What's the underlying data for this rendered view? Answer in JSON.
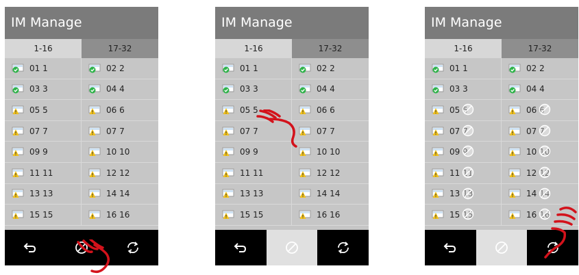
{
  "title": "IM Manage",
  "tabs": [
    "1-16",
    "17-32"
  ],
  "rows": [
    [
      "01 1",
      "02 2"
    ],
    [
      "03 3",
      "04 4"
    ],
    [
      "05 5",
      "06 6"
    ],
    [
      "07 7",
      "07 7"
    ],
    [
      "09 9",
      "10 10"
    ],
    [
      "11 11",
      "12 12"
    ],
    [
      "13 13",
      "14 14"
    ],
    [
      "15 15",
      "16 16"
    ]
  ],
  "status_rows": [
    [
      "online",
      "online"
    ],
    [
      "online",
      "online"
    ],
    [
      "warning",
      "warning"
    ],
    [
      "warning",
      "warning"
    ],
    [
      "warning",
      "warning"
    ],
    [
      "warning",
      "warning"
    ],
    [
      "warning",
      "warning"
    ],
    [
      "warning",
      "warning"
    ]
  ],
  "icons": {
    "online": "monitor-online-icon",
    "warning": "monitor-warning-icon",
    "back": "back-arrow-icon",
    "disable": "disable-icon",
    "refresh": "refresh-icon",
    "busy": "busy-circle-icon",
    "hand": "pointing-hand-icon"
  },
  "colors": {
    "title_bar": "#7b7b7b",
    "panel": "#c6c6c6",
    "tab_active": "#d7d7d7",
    "tab_inactive": "#8e8e8e",
    "bottom_bar": "#000000",
    "pressed_button": "#e0e0e0",
    "online": "#2fb34a",
    "warning": "#f2c21b",
    "hand": "#d3121b"
  },
  "panels": [
    {
      "disable_pressed": false,
      "busy": false
    },
    {
      "disable_pressed": true,
      "busy": false
    },
    {
      "disable_pressed": true,
      "busy": true
    }
  ]
}
